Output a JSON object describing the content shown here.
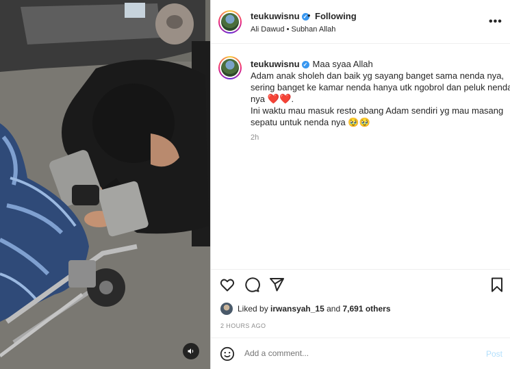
{
  "post": {
    "username": "teukuwisnu",
    "separator": "•",
    "follow_status": "Following",
    "audio": "Ali Dawud • Subhan Allah"
  },
  "caption": {
    "username": "teukuwisnu",
    "first_line": "Maa syaa Allah",
    "line2": "Adam anak sholeh dan baik yg sayang banget sama nenda nya,",
    "line3": "sering banget ke kamar nenda hanya utk ngobrol dan peluk nenda",
    "line4_prefix": "nya",
    "hearts": "❤️❤️",
    "line4_suffix": ".",
    "line5": "Ini waktu mau masuk resto abang Adam sendiri yg mau masang",
    "line6": "sepatu untuk nenda nya 🥹🥹",
    "time": "2h"
  },
  "likes": {
    "prefix": "Liked by",
    "user": "irwansyah_15",
    "conjunction": "and",
    "others": "7,691 others"
  },
  "post_time": "2 HOURS AGO",
  "comment": {
    "placeholder": "Add a comment...",
    "post_label": "Post"
  },
  "icons": {
    "verified": "verified-badge-icon",
    "more": "more-options-icon",
    "like": "heart-icon",
    "comment": "comment-icon",
    "share": "paper-plane-icon",
    "save": "bookmark-icon",
    "emoji": "emoji-icon",
    "sound": "speaker-icon"
  },
  "colors": {
    "verified_blue": "#3897f0",
    "post_disabled": "#b2dffc",
    "muted_text": "#8e8e8e"
  }
}
